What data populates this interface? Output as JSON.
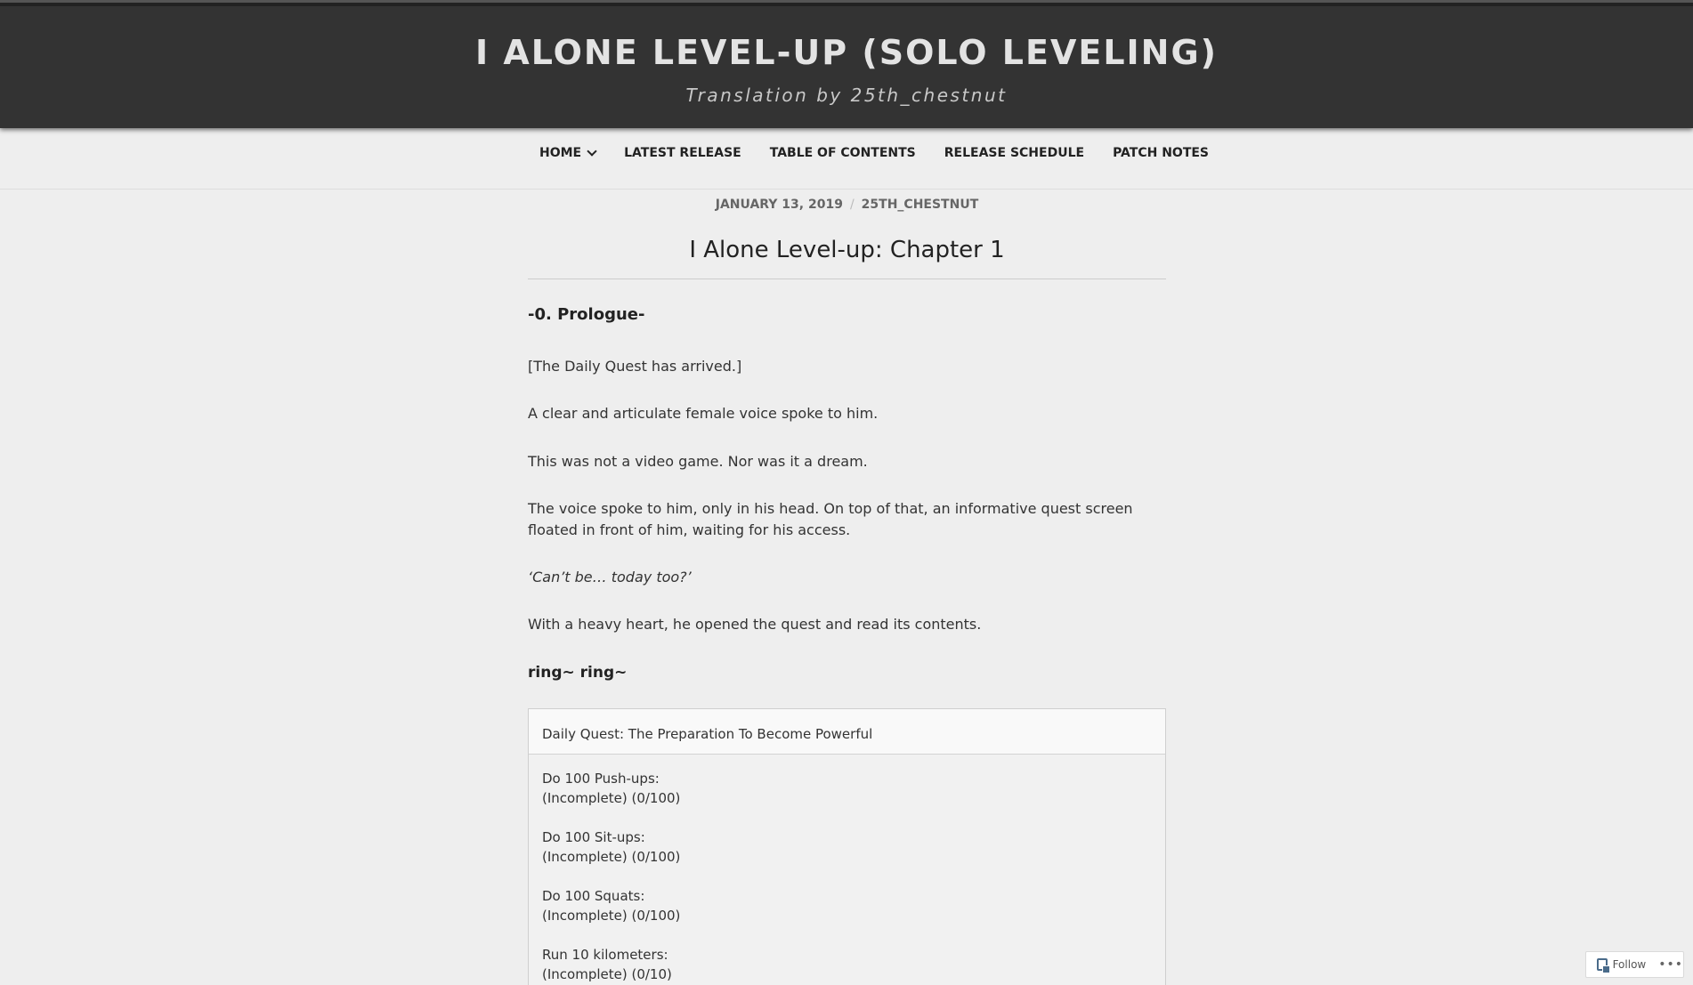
{
  "header": {
    "site_title": "I ALONE LEVEL-UP (SOLO LEVELING)",
    "tagline": "Translation by 25th_chestnut"
  },
  "nav": {
    "home": "HOME",
    "latest_release": "LATEST RELEASE",
    "table_of_contents": "TABLE OF CONTENTS",
    "release_schedule": "RELEASE SCHEDULE",
    "patch_notes": "PATCH NOTES"
  },
  "post": {
    "date": "JANUARY 13, 2019",
    "separator": "/",
    "author": "25TH_CHESTNUT",
    "title": "I Alone Level-up: Chapter 1",
    "prologue_heading": "-0. Prologue-",
    "paragraphs": [
      "[The Daily Quest has arrived.]",
      "A clear and articulate female voice spoke to him.",
      "This was not a video game.  Nor was it a dream.",
      "The voice spoke to him, only in his head.  On top of that, an informative quest screen floated in front of him, waiting for his access.",
      "‘Can’t be… today too?’",
      "With a heavy heart, he opened the quest and read its contents."
    ],
    "ring_text": "ring~ ring~"
  },
  "quest": {
    "title": "Daily Quest: The Preparation To Become Powerful",
    "items": [
      {
        "task": "Do 100 Push-ups:",
        "status": "(Incomplete) (0/100)"
      },
      {
        "task": "Do 100 Sit-ups:",
        "status": "(Incomplete) (0/100)"
      },
      {
        "task": "Do 100 Squats:",
        "status": "(Incomplete) (0/100)"
      },
      {
        "task": "Run 10 kilometers:",
        "status": "(Incomplete) (0/10)"
      }
    ]
  },
  "follow_widget": {
    "label": "Follow",
    "more": "•••",
    "icon": "follow-icon"
  }
}
